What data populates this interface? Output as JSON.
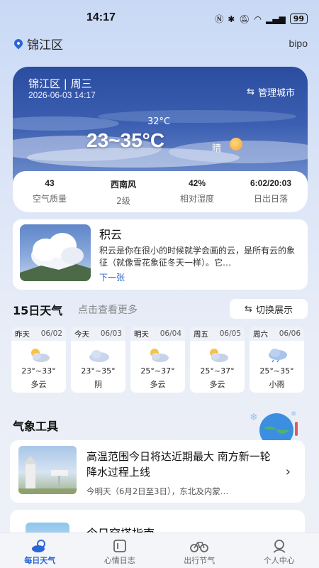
{
  "status_bar": {
    "time": "14:17",
    "battery": "99"
  },
  "location": {
    "name": "锦江区",
    "right_label": "bipo"
  },
  "weather_card": {
    "title": "锦江区 | 周三",
    "datetime": "2026-06-03 14:17",
    "manage_label": "管理城市",
    "current_temp": "32°C",
    "temp_range": "23~35°C",
    "condition": "晴"
  },
  "stats": [
    {
      "value": "43",
      "label": "空气质量"
    },
    {
      "value": "西南风",
      "label": "2级"
    },
    {
      "value": "42%",
      "label": "相对湿度"
    },
    {
      "value": "6:02/20:03",
      "label": "日出日落"
    }
  ],
  "cloud_card": {
    "title": "积云",
    "desc": "积云是你在很小的时候就学会画的云，是所有云的象征（就像雪花象征冬天一样）。它…",
    "next_label": "下一张"
  },
  "forecast": {
    "title": "15日天气",
    "more": "点击查看更多",
    "switch_label": "切换展示",
    "days": [
      {
        "day": "昨天",
        "date": "06/02",
        "temp": "23°~33°",
        "cond": "多云",
        "icon": "sun-cloud"
      },
      {
        "day": "今天",
        "date": "06/03",
        "temp": "23°~35°",
        "cond": "阴",
        "icon": "cloud"
      },
      {
        "day": "明天",
        "date": "06/04",
        "temp": "25°~37°",
        "cond": "多云",
        "icon": "sun-cloud"
      },
      {
        "day": "周五",
        "date": "06/05",
        "temp": "25°~37°",
        "cond": "多云",
        "icon": "sun-cloud"
      },
      {
        "day": "周六",
        "date": "06/06",
        "temp": "25°~35°",
        "cond": "小雨",
        "icon": "rain-cloud"
      }
    ]
  },
  "tools": {
    "title": "气象工具"
  },
  "news": {
    "title": "高温范围今日将达近期最大 南方新一轮降水过程上线",
    "subtitle": "今明天（6月2日至3日），东北及内蒙…"
  },
  "dress": {
    "title": "今日穿搭指南"
  },
  "tabs": [
    {
      "label": "每日天气",
      "icon": "weather-icon",
      "active": true
    },
    {
      "label": "心情日志",
      "icon": "journal-icon",
      "active": false
    },
    {
      "label": "出行节气",
      "icon": "bike-icon",
      "active": false
    },
    {
      "label": "个人中心",
      "icon": "user-icon",
      "active": false
    }
  ],
  "colors": {
    "accent": "#2a66d6",
    "card_bg": "#3c5fb2"
  }
}
